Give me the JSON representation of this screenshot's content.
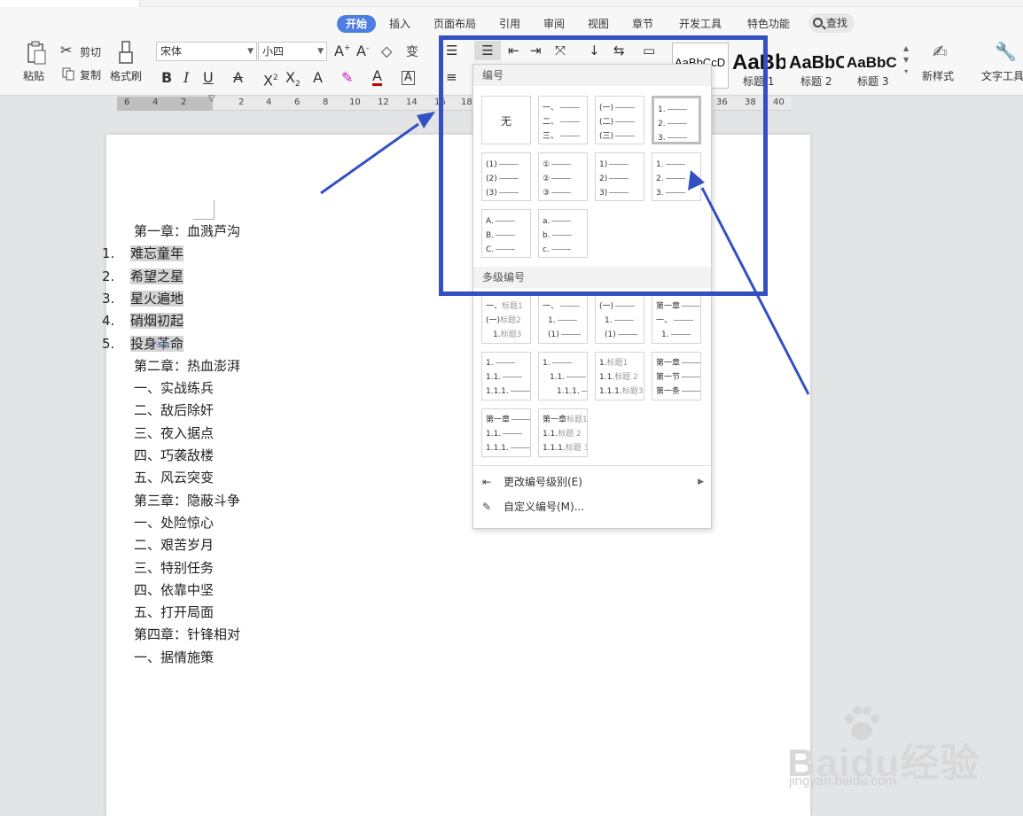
{
  "ribbon_tabs": [
    {
      "label": "开始",
      "active": true
    },
    {
      "label": "插入"
    },
    {
      "label": "页面布局"
    },
    {
      "label": "引用"
    },
    {
      "label": "审阅"
    },
    {
      "label": "视图"
    },
    {
      "label": "章节"
    },
    {
      "label": "开发工具"
    },
    {
      "label": "特色功能"
    }
  ],
  "search_label": "查找",
  "clipboard": {
    "paste": "粘贴",
    "cut": "剪切",
    "copy": "复制",
    "format_painter": "格式刷"
  },
  "font": {
    "family": "宋体",
    "size": "小四"
  },
  "styles": {
    "normal_preview": "AaBbCcD",
    "h1_preview": "AaBb",
    "h2_preview": "AaBbC",
    "h3_preview": "AaBbC",
    "h1_caption": "标题 1",
    "h2_caption": "标题 2",
    "h3_caption": "标题 3",
    "new_style": "新样式",
    "text_tools": "文字工具"
  },
  "ruler_numbers": [
    "6",
    "4",
    "2",
    "2",
    "4",
    "6",
    "8",
    "10",
    "12",
    "14",
    "16",
    "18",
    "36",
    "38",
    "40"
  ],
  "document": {
    "lines": [
      {
        "text": "第一章：血溅芦沟"
      },
      {
        "num": "1.",
        "text": "难忘童年",
        "hl": true
      },
      {
        "num": "2.",
        "text": "希望之星",
        "hl": true
      },
      {
        "num": "3.",
        "text": "星火遍地",
        "hl": true
      },
      {
        "num": "4.",
        "text": "硝烟初起",
        "hl": true
      },
      {
        "num": "5.",
        "text": "投身革命",
        "hl": true
      },
      {
        "text": "第二章：热血澎湃"
      },
      {
        "text": "一、实战练兵"
      },
      {
        "text": "二、敌后除奸"
      },
      {
        "text": "三、夜入据点"
      },
      {
        "text": "四、巧袭敌楼"
      },
      {
        "text": "五、风云突变"
      },
      {
        "text": "第三章：隐蔽斗争"
      },
      {
        "text": "一、处险惊心"
      },
      {
        "text": "二、艰苦岁月"
      },
      {
        "text": "三、特别任务"
      },
      {
        "text": "四、依靠中坚"
      },
      {
        "text": "五、打开局面"
      },
      {
        "text": "第四章：针锋相对"
      },
      {
        "text": "一、据情施策"
      }
    ]
  },
  "numbering_menu": {
    "section_numbering": "编号",
    "section_multilevel": "多级编号",
    "none_label": "无",
    "cells": [
      [
        "一、",
        "二、",
        "三、"
      ],
      [
        "(一)",
        "(二)",
        "(三)"
      ],
      [
        "1.",
        "2.",
        "3."
      ],
      [
        "(1)",
        "(2)",
        "(3)"
      ],
      [
        "①",
        "②",
        "③"
      ],
      [
        "1)",
        "2)",
        "3)"
      ],
      [
        "1.",
        "2.",
        "3."
      ],
      [
        "A.",
        "B.",
        "C."
      ],
      [
        "a.",
        "b.",
        "c."
      ]
    ],
    "multilevel_cells": [
      [
        {
          "t": "一、",
          "g": "标题1"
        },
        {
          "t": "(一)",
          "g": "标题2"
        },
        {
          "t": "1.",
          "g": "标题3"
        }
      ],
      [
        {
          "t": "一、"
        },
        {
          "t": "1."
        },
        {
          "t": "(1)"
        }
      ],
      [
        {
          "t": "(一)"
        },
        {
          "t": "1."
        },
        {
          "t": "(1)"
        }
      ],
      [
        {
          "t": "第一章"
        },
        {
          "t": "一、"
        },
        {
          "t": "1."
        }
      ],
      [
        {
          "t": "1."
        },
        {
          "t": "1.1."
        },
        {
          "t": "1.1.1."
        }
      ],
      [
        {
          "t": "1."
        },
        {
          "t": "1.1."
        },
        {
          "t": "1.1.1."
        }
      ],
      [
        {
          "t": "1.",
          "g": "标题1"
        },
        {
          "t": "1.1.",
          "g": "标题 2"
        },
        {
          "t": "1.1.1.",
          "g": "标题3"
        }
      ],
      [
        {
          "t": "第一章"
        },
        {
          "t": "第一节"
        },
        {
          "t": "第一条"
        }
      ],
      [
        {
          "t": "第一章"
        },
        {
          "t": "1.1."
        },
        {
          "t": "1.1.1."
        }
      ],
      [
        {
          "t": "第一章",
          "g": "标题1"
        },
        {
          "t": "1.1.",
          "g": "标题 2"
        },
        {
          "t": "1.1.1.",
          "g": "标题 3"
        }
      ]
    ],
    "change_level": "更改编号级别(E)",
    "custom": "自定义编号(M)..."
  },
  "watermark": {
    "brand": "Baidu经验",
    "url": "jingyan.baidu.com"
  },
  "colors": {
    "accent": "#4e7fe0",
    "annotation": "#3350c3",
    "highlight": "#d4d4d4"
  }
}
